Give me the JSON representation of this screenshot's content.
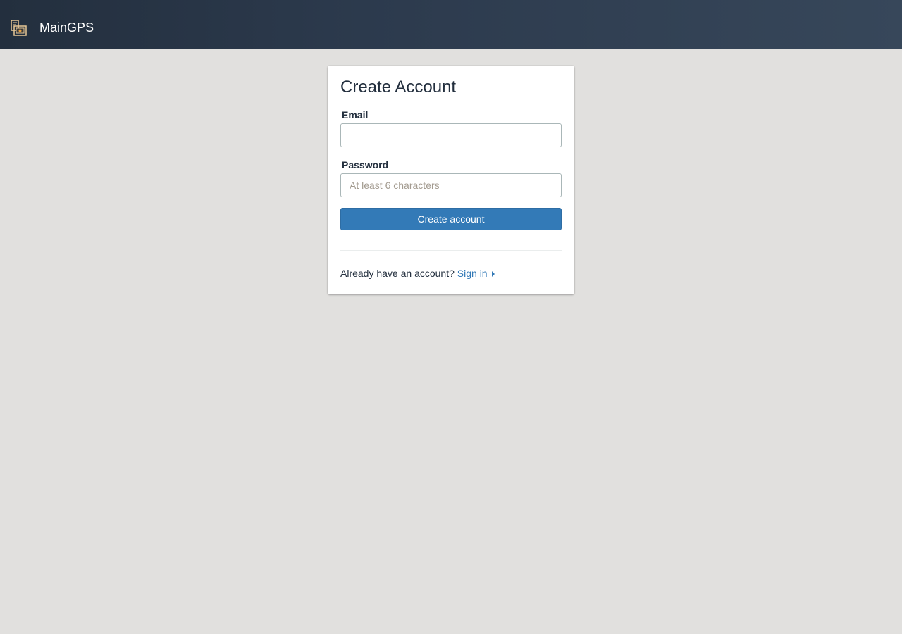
{
  "header": {
    "brand_name": "MainGPS",
    "logo_icon": "map-app-logo-icon",
    "colors": {
      "bar": "#232f3e"
    }
  },
  "form": {
    "title": "Create Account",
    "email": {
      "label": "Email",
      "value": "",
      "placeholder": ""
    },
    "password": {
      "label": "Password",
      "value": "",
      "placeholder": "At least 6 characters"
    },
    "submit_label": "Create account",
    "footer_text": "Already have an account?",
    "signin_label": "Sign in",
    "signin_icon": "caret-right-icon",
    "colors": {
      "primary": "#337ab7",
      "link": "#337ab7"
    }
  }
}
